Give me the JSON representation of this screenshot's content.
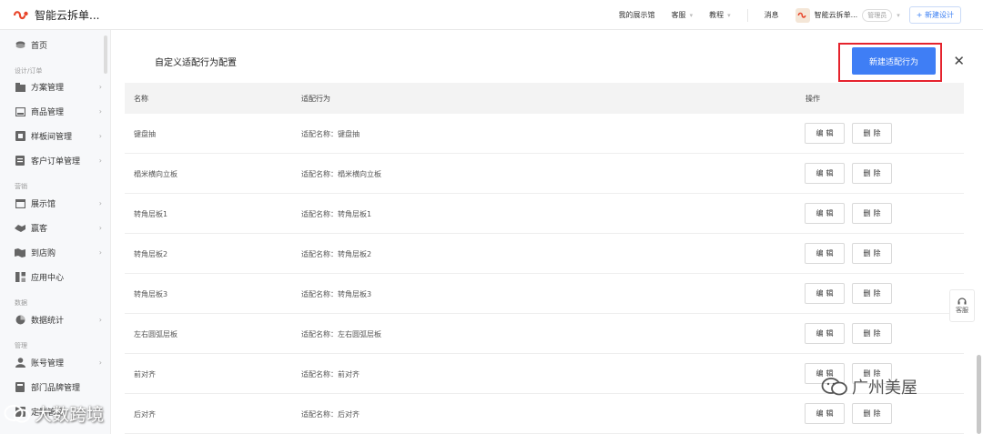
{
  "header": {
    "app_name": "智能云拆单...",
    "nav": [
      {
        "label": "我的展示馆",
        "has_caret": false
      },
      {
        "label": "客服",
        "has_caret": true
      },
      {
        "label": "教程",
        "has_caret": true
      }
    ],
    "messages_label": "消息",
    "user_name": "智能云拆单...",
    "role_label": "管理员",
    "new_design_label": "+ 新建设计"
  },
  "sidebar": {
    "home": "首页",
    "sections": {
      "design": "设计/订单",
      "marketing": "营销",
      "data": "数据",
      "manage": "管理"
    },
    "items": {
      "plan_manage": "方案管理",
      "goods_manage": "商品管理",
      "sample_room": "样板间管理",
      "customer_orders": "客户订单管理",
      "showroom": "展示馆",
      "yingke": "赢客",
      "to_store": "到店购",
      "app_center": "应用中心",
      "stats": "数据统计",
      "account": "账号管理",
      "dept_brand": "部门品牌管理",
      "customize": "定制管理"
    }
  },
  "panel": {
    "title": "自定义适配行为配置",
    "new_button": "新建适配行为",
    "columns": {
      "name": "名称",
      "behavior": "适配行为",
      "ops": "操作"
    },
    "edit_label": "编辑",
    "delete_label": "删除",
    "rows": [
      {
        "name": "键盘抽",
        "behavior": "适配名称：键盘抽"
      },
      {
        "name": "榻米横向立板",
        "behavior": "适配名称：榻米横向立板"
      },
      {
        "name": "转角层板1",
        "behavior": "适配名称：转角层板1"
      },
      {
        "name": "转角层板2",
        "behavior": "适配名称：转角层板2"
      },
      {
        "name": "转角层板3",
        "behavior": "适配名称：转角层板3"
      },
      {
        "name": "左右圆弧层板",
        "behavior": "适配名称：左右圆弧层板"
      },
      {
        "name": "前对齐",
        "behavior": "适配名称：前对齐"
      },
      {
        "name": "后对齐",
        "behavior": "适配名称：后对齐"
      }
    ]
  },
  "service_tab": {
    "label": "客服"
  },
  "watermarks": {
    "right": "广州美屋",
    "left": "大数跨境"
  },
  "colors": {
    "primary": "#3f7ef5",
    "highlight": "#e5232d",
    "header_bg": "#f3f3f3"
  }
}
